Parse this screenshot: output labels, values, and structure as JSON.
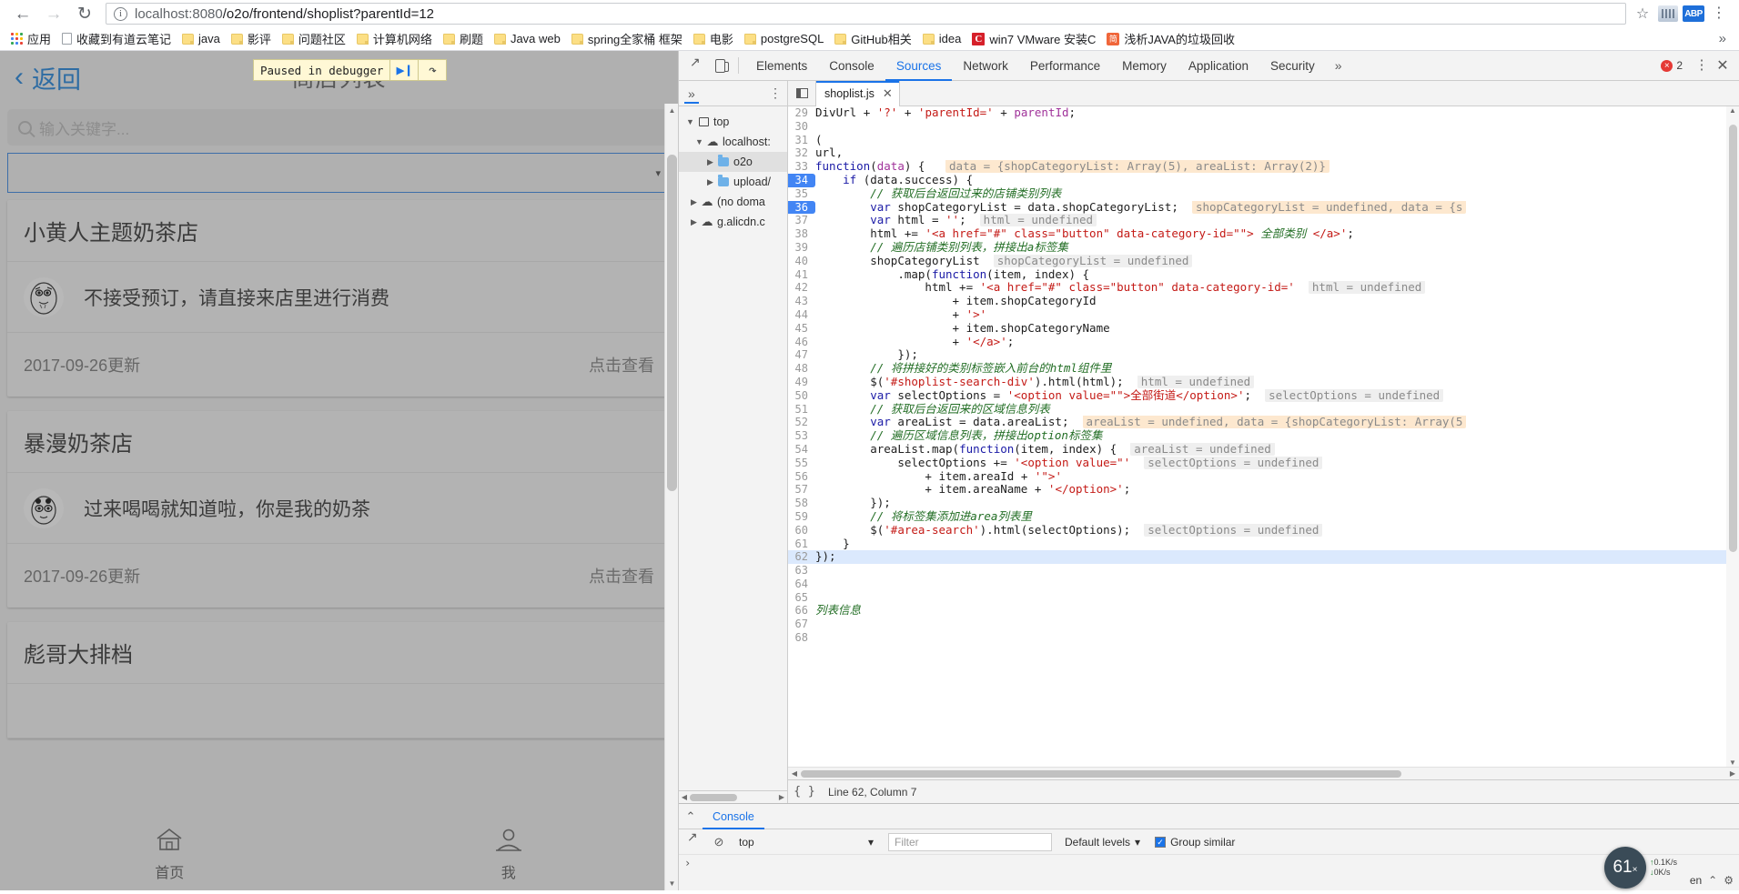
{
  "browser": {
    "nav": {
      "back": "←",
      "forward": "→",
      "reload": "↻"
    },
    "url_scheme": "localhost:8080",
    "url_path": "/o2o/frontend/shoplist?parentId=12",
    "star_icon": "☆",
    "menu_icon": "⋮",
    "ext_badge_label": "ABP",
    "bookmarks": [
      {
        "label": "应用",
        "icon": "apps-grid-icon"
      },
      {
        "label": "收藏到有道云笔记",
        "icon": "page-icon"
      },
      {
        "label": "java",
        "icon": "folder-icon"
      },
      {
        "label": "影评",
        "icon": "folder-icon"
      },
      {
        "label": "问题社区",
        "icon": "folder-icon"
      },
      {
        "label": "计算机网络",
        "icon": "folder-icon"
      },
      {
        "label": "刷题",
        "icon": "folder-icon"
      },
      {
        "label": "Java web",
        "icon": "folder-icon"
      },
      {
        "label": "spring全家桶 框架",
        "icon": "folder-icon"
      },
      {
        "label": "电影",
        "icon": "folder-icon"
      },
      {
        "label": "postgreSQL",
        "icon": "folder-icon"
      },
      {
        "label": "GitHub相关",
        "icon": "folder-icon"
      },
      {
        "label": "idea",
        "icon": "folder-icon"
      },
      {
        "label": "win7 VMware 安装C",
        "icon": "c-logo-icon"
      },
      {
        "label": "浅析JAVA的垃圾回收",
        "icon": "jian-icon"
      }
    ],
    "bookmarks_overflow": "»"
  },
  "page": {
    "back_label": "返回",
    "back_chevron": "‹",
    "title": "商店列表",
    "paused_banner": {
      "text": "Paused in debugger",
      "resume_icon": "▶❙",
      "step_icon": "↷"
    },
    "search": {
      "placeholder": "输入关键字...",
      "value": "",
      "icon": "search-icon"
    },
    "area_select": {
      "value": "",
      "caret": "▾"
    },
    "shops": [
      {
        "name": "小黄人主题奶茶店",
        "desc": "不接受预订，请直接来店里进行消费",
        "updated": "2017-09-26更新",
        "view_label": "点击查看"
      },
      {
        "name": "暴漫奶茶店",
        "desc": "过来喝喝就知道啦，你是我的奶茶",
        "updated": "2017-09-26更新",
        "view_label": "点击查看"
      },
      {
        "name": "彪哥大排档",
        "desc": "",
        "updated": "",
        "view_label": ""
      }
    ],
    "tabbar": [
      {
        "label": "首页",
        "icon": "home-icon",
        "glyph": "⌂"
      },
      {
        "label": "我",
        "icon": "user-icon",
        "glyph": "☺"
      }
    ]
  },
  "devtools": {
    "tabs": [
      {
        "label": "Elements",
        "active": false
      },
      {
        "label": "Console",
        "active": false
      },
      {
        "label": "Sources",
        "active": true
      },
      {
        "label": "Network",
        "active": false
      },
      {
        "label": "Performance",
        "active": false
      },
      {
        "label": "Memory",
        "active": false
      },
      {
        "label": "Application",
        "active": false
      },
      {
        "label": "Security",
        "active": false
      }
    ],
    "tabs_overflow": "»",
    "inspect_icon": "inspect-cursor-icon",
    "device_icon": "device-toolbar-icon",
    "error_count": "2",
    "kebab_icon": "⋮",
    "close_icon": "✕",
    "navigator": {
      "collapse_icon": "»",
      "kebab_icon": "⋮",
      "tree": [
        {
          "label": "top",
          "indent": 0,
          "twisty": "▼",
          "icon": "frame-icon"
        },
        {
          "label": "localhost:",
          "indent": 1,
          "twisty": "▼",
          "icon": "cloud-icon"
        },
        {
          "label": "o2o",
          "indent": 2,
          "twisty": "▶",
          "icon": "folder-icon",
          "selected": true
        },
        {
          "label": "upload/",
          "indent": 2,
          "twisty": "▶",
          "icon": "folder-icon"
        },
        {
          "label": "(no doma",
          "indent": 1,
          "twisty": "▶",
          "icon": "cloud-icon"
        },
        {
          "label": "g.alicdn.c",
          "indent": 1,
          "twisty": "▶",
          "icon": "cloud-icon"
        }
      ]
    },
    "editor": {
      "file_tab": "shoplist.js",
      "file_tab_close": "✕",
      "sidebar_toggle_icon": "panel-toggle-icon",
      "first_line_number": 29,
      "lines": [
        {
          "n": 29,
          "html": "<span class=\"pl\">DivUrl</span> <span class=\"pl\">+</span> <span class=\"str\">'?'</span> <span class=\"pl\">+</span> <span class=\"str\">'parentId='</span> <span class=\"pl\">+</span> <span class=\"kw2\">parentId</span><span class=\"pl\">;</span>",
          "bp": false,
          "hl": false
        },
        {
          "n": 30,
          "html": "",
          "bp": false,
          "hl": false
        },
        {
          "n": 31,
          "html": "<span class=\"pl\">(</span>",
          "bp": false,
          "hl": false
        },
        {
          "n": 32,
          "html": "<span class=\"pl\">url,</span>",
          "bp": false,
          "hl": false
        },
        {
          "n": 33,
          "html": "<span class=\"kw\">function</span><span class=\"pl\">(</span><span class=\"kw2\">data</span><span class=\"pl\">) {</span>   <span class=\"hint\">data = {shopCategoryList: Array(5), areaList: Array(2)}</span>",
          "bp": false,
          "hl": false
        },
        {
          "n": 34,
          "html": "    <span class=\"kw\">if</span> <span class=\"pl\">(data.success) {</span>",
          "bp": true,
          "hl": false
        },
        {
          "n": 35,
          "html": "        <span class=\"com\">// 获取后台返回过来的店铺类别列表</span>",
          "bp": false,
          "hl": false
        },
        {
          "n": 36,
          "html": "        <span class=\"kw\">var</span> <span class=\"pl\">shopCategoryList = data.shopCategoryList;</span>  <span class=\"hint\">shopCategoryList = undefined, data = {s</span>",
          "bp": true,
          "hl": false
        },
        {
          "n": 37,
          "html": "        <span class=\"kw\">var</span> <span class=\"pl\">html =</span> <span class=\"str\">''</span><span class=\"pl\">;</span>  <span class=\"hint2\">html = undefined</span>",
          "bp": false,
          "hl": false
        },
        {
          "n": 38,
          "html": "        <span class=\"pl\">html +=</span> <span class=\"str\">'&lt;a href=\"#\" class=\"button\" data-category-id=\"\"&gt;</span><span class=\"com\"> 全部类别 </span><span class=\"str\">&lt;/a&gt;'</span><span class=\"pl\">;</span>",
          "bp": false,
          "hl": false
        },
        {
          "n": 39,
          "html": "        <span class=\"com\">// 遍历店铺类别列表，拼接出a标签集</span>",
          "bp": false,
          "hl": false
        },
        {
          "n": 40,
          "html": "        <span class=\"pl\">shopCategoryList</span>  <span class=\"hint2\">shopCategoryList = undefined</span>",
          "bp": false,
          "hl": false
        },
        {
          "n": 41,
          "html": "            <span class=\"pl\">.map(</span><span class=\"kw\">function</span><span class=\"pl\">(item, index) {</span>",
          "bp": false,
          "hl": false
        },
        {
          "n": 42,
          "html": "                <span class=\"pl\">html +=</span> <span class=\"str\">'&lt;a href=\"#\" class=\"button\" data-category-id='</span>  <span class=\"hint2\">html = undefined</span>",
          "bp": false,
          "hl": false
        },
        {
          "n": 43,
          "html": "                    <span class=\"pl\">+</span> <span class=\"pl\">item.shopCategoryId</span>",
          "bp": false,
          "hl": false
        },
        {
          "n": 44,
          "html": "                    <span class=\"pl\">+</span> <span class=\"str\">'&gt;'</span>",
          "bp": false,
          "hl": false
        },
        {
          "n": 45,
          "html": "                    <span class=\"pl\">+</span> <span class=\"pl\">item.shopCategoryName</span>",
          "bp": false,
          "hl": false
        },
        {
          "n": 46,
          "html": "                    <span class=\"pl\">+</span> <span class=\"str\">'&lt;/a&gt;'</span><span class=\"pl\">;</span>",
          "bp": false,
          "hl": false
        },
        {
          "n": 47,
          "html": "            <span class=\"pl\">});</span>",
          "bp": false,
          "hl": false
        },
        {
          "n": 48,
          "html": "        <span class=\"com\">// 将拼接好的类别标签嵌入前台的html组件里</span>",
          "bp": false,
          "hl": false
        },
        {
          "n": 49,
          "html": "        <span class=\"pl\">$(</span><span class=\"str\">'#shoplist-search-div'</span><span class=\"pl\">).html(html);</span>  <span class=\"hint2\">html = undefined</span>",
          "bp": false,
          "hl": false
        },
        {
          "n": 50,
          "html": "        <span class=\"kw\">var</span> <span class=\"pl\">selectOptions =</span> <span class=\"str\">'&lt;option value=\"\"&gt;全部街道&lt;/option&gt;'</span><span class=\"pl\">;</span>  <span class=\"hint2\">selectOptions = undefined</span>",
          "bp": false,
          "hl": false
        },
        {
          "n": 51,
          "html": "        <span class=\"com\">// 获取后台返回来的区域信息列表</span>",
          "bp": false,
          "hl": false
        },
        {
          "n": 52,
          "html": "        <span class=\"kw\">var</span> <span class=\"pl\">areaList = data.areaList;</span>  <span class=\"hint\">areaList = undefined, data = {shopCategoryList: Array(5</span>",
          "bp": false,
          "hl": false
        },
        {
          "n": 53,
          "html": "        <span class=\"com\">// 遍历区域信息列表，拼接出option标签集</span>",
          "bp": false,
          "hl": false
        },
        {
          "n": 54,
          "html": "        <span class=\"pl\">areaList.map(</span><span class=\"kw\">function</span><span class=\"pl\">(item, index) {</span>  <span class=\"hint2\">areaList = undefined</span>",
          "bp": false,
          "hl": false
        },
        {
          "n": 55,
          "html": "            <span class=\"pl\">selectOptions +=</span> <span class=\"str\">'&lt;option value=\"'</span>  <span class=\"hint2\">selectOptions = undefined</span>",
          "bp": false,
          "hl": false
        },
        {
          "n": 56,
          "html": "                <span class=\"pl\">+</span> <span class=\"pl\">item.areaId</span> <span class=\"pl\">+</span> <span class=\"str\">'\"&gt;'</span>",
          "bp": false,
          "hl": false
        },
        {
          "n": 57,
          "html": "                <span class=\"pl\">+</span> <span class=\"pl\">item.areaName</span> <span class=\"pl\">+</span> <span class=\"str\">'&lt;/option&gt;'</span><span class=\"pl\">;</span>",
          "bp": false,
          "hl": false
        },
        {
          "n": 58,
          "html": "        <span class=\"pl\">});</span>",
          "bp": false,
          "hl": false
        },
        {
          "n": 59,
          "html": "        <span class=\"com\">// 将标签集添加进area列表里</span>",
          "bp": false,
          "hl": false
        },
        {
          "n": 60,
          "html": "        <span class=\"pl\">$(</span><span class=\"str\">'#area-search'</span><span class=\"pl\">).html(selectOptions);</span>  <span class=\"hint2\">selectOptions = undefined</span>",
          "bp": false,
          "hl": false
        },
        {
          "n": 61,
          "html": "    <span class=\"pl\">}</span>",
          "bp": false,
          "hl": false
        },
        {
          "n": 62,
          "html": "<span class=\"pl\">});</span>",
          "bp": false,
          "hl": true
        },
        {
          "n": 63,
          "html": "",
          "bp": false,
          "hl": false
        },
        {
          "n": 64,
          "html": "",
          "bp": false,
          "hl": false
        },
        {
          "n": 65,
          "html": "",
          "bp": false,
          "hl": false
        },
        {
          "n": 66,
          "html": "<span class=\"com\">列表信息</span>",
          "bp": false,
          "hl": false
        },
        {
          "n": 67,
          "html": "",
          "bp": false,
          "hl": false
        },
        {
          "n": 68,
          "html": "",
          "bp": false,
          "hl": false
        }
      ],
      "status": {
        "format_icon": "{ }",
        "cursor": "Line 62, Column 7"
      }
    },
    "drawer": {
      "chevron": "⌃",
      "tab_label": "Console",
      "toolbar": {
        "clear_icon": "⊘",
        "context": "top",
        "context_caret": "▾",
        "filter_placeholder": "Filter",
        "levels_label": "Default levels",
        "levels_caret": "▾",
        "group_similar_label": "Group similar",
        "group_similar_checked": true
      },
      "prompt": "›"
    }
  },
  "tray": {
    "speed_value": "61",
    "speed_unit": "×",
    "rate_up": "0.1K/s",
    "rate_down": "0K/s",
    "lang_label": "en",
    "gear_icon": "⚙",
    "caret_icon": "⌃"
  }
}
